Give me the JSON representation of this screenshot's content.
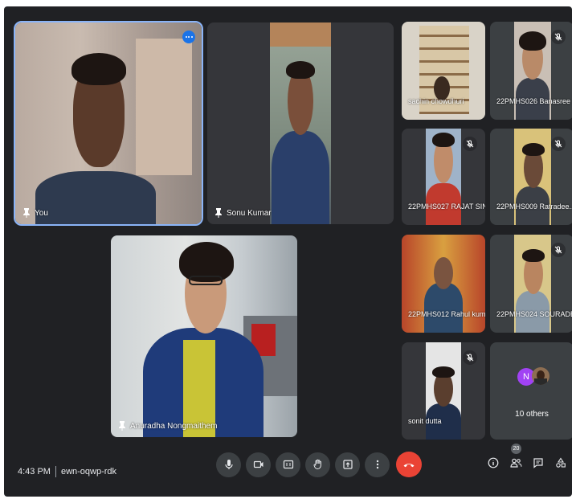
{
  "participants": {
    "you": {
      "name": "You"
    },
    "sonu": {
      "name": "Sonu Kumar"
    },
    "anuradha": {
      "name": "Anuradha Nongmaithem"
    },
    "sachin": {
      "name": "sachin chowdhuri"
    },
    "banasree": {
      "name": "22PMHS026 Banasree ..."
    },
    "rajat": {
      "name": "22PMHS027 RAJAT SIN..."
    },
    "ratradee": {
      "name": "22PMHS009 Ratradee..."
    },
    "rahul": {
      "name": "22PMHS012 Rahul kumar"
    },
    "sourade": {
      "name": "22PMHS024 SOURADE..."
    },
    "sonit": {
      "name": "sonit dutta"
    },
    "others": {
      "label": "10 others",
      "avatar_letter": "N"
    }
  },
  "meeting": {
    "time": "4:43 PM",
    "code": "ewn-oqwp-rdk",
    "participant_count": "20"
  },
  "icons": {
    "controls": [
      "microphone-icon",
      "camera-icon",
      "captions-icon",
      "raise-hand-icon",
      "present-icon",
      "more-options-icon",
      "end-call-icon"
    ],
    "right": [
      "info-icon",
      "people-icon",
      "chat-icon",
      "activities-icon"
    ]
  },
  "colors": {
    "background": "#202124",
    "tile": "#3c4043",
    "active_outline": "#8ab4f8",
    "end_call": "#ea4335",
    "avatar": "#a142f4"
  }
}
